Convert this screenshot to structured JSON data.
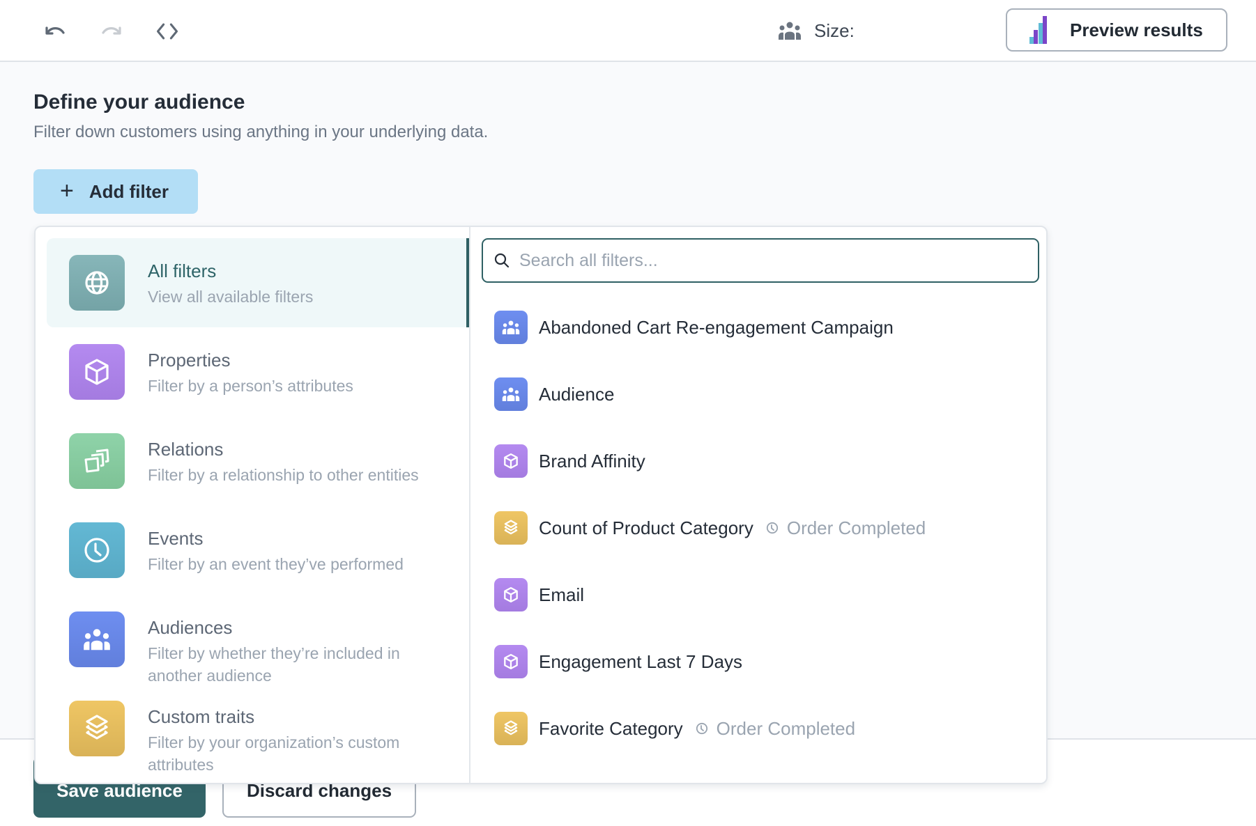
{
  "toolbar": {
    "undo_icon": "undo-icon",
    "redo_icon": "redo-icon",
    "code_icon": "code-icon",
    "size_icon": "people-icon",
    "size_label": "Size:",
    "preview_icon": "bar-chart-icon",
    "preview_label": "Preview results"
  },
  "header": {
    "title": "Define your audience",
    "subtitle": "Filter down customers using anything in your underlying data."
  },
  "add_filter": {
    "icon": "plus-icon",
    "label": "Add filter",
    "plus_glyph": "+"
  },
  "dropdown": {
    "categories": [
      {
        "title": "All filters",
        "description": "View all available filters",
        "icon": "globe-icon",
        "color": "#7dadb0",
        "active": true
      },
      {
        "title": "Properties",
        "description": "Filter by a person’s attributes",
        "icon": "cube-icon",
        "color": "#ac83e8",
        "active": false
      },
      {
        "title": "Relations",
        "description": "Filter by a relationship to other entities",
        "icon": "stacked-cards-icon",
        "color": "#86cb9f",
        "active": false
      },
      {
        "title": "Events",
        "description": "Filter by an event they’ve performed",
        "icon": "clock-icon",
        "color": "#5eb1cc",
        "active": false
      },
      {
        "title": "Audiences",
        "description": "Filter by whether they’re included in another audience",
        "icon": "people-icon",
        "color": "#6887e6",
        "active": false
      },
      {
        "title": "Custom traits",
        "description": "Filter by your organization’s custom attributes",
        "icon": "layers-icon",
        "color": "#e4bc5d",
        "active": false
      }
    ],
    "search": {
      "placeholder": "Search all filters...",
      "value": ""
    },
    "filters": [
      {
        "name": "Abandoned Cart Re-engagement Campaign",
        "type": "audience",
        "icon": "people-icon",
        "meta": null
      },
      {
        "name": "Audience",
        "type": "audience",
        "icon": "people-icon",
        "meta": null
      },
      {
        "name": "Brand Affinity",
        "type": "property",
        "icon": "cube-icon",
        "meta": null
      },
      {
        "name": "Count of Product Category",
        "type": "custom-trait",
        "icon": "layers-icon",
        "meta": "Order Completed"
      },
      {
        "name": "Email",
        "type": "property",
        "icon": "cube-icon",
        "meta": null
      },
      {
        "name": "Engagement Last 7 Days",
        "type": "property",
        "icon": "cube-icon",
        "meta": null
      },
      {
        "name": "Favorite Category",
        "type": "custom-trait",
        "icon": "layers-icon",
        "meta": "Order Completed"
      }
    ]
  },
  "footer": {
    "save_label": "Save audience",
    "discard_label": "Discard changes"
  },
  "colors": {
    "accent": "#2f6064",
    "save_button": "#336468",
    "add_filter_bg": "#b3def6",
    "preview_bar_teal": "#5fbbd6",
    "preview_bar_purple": "#7b45c8"
  }
}
